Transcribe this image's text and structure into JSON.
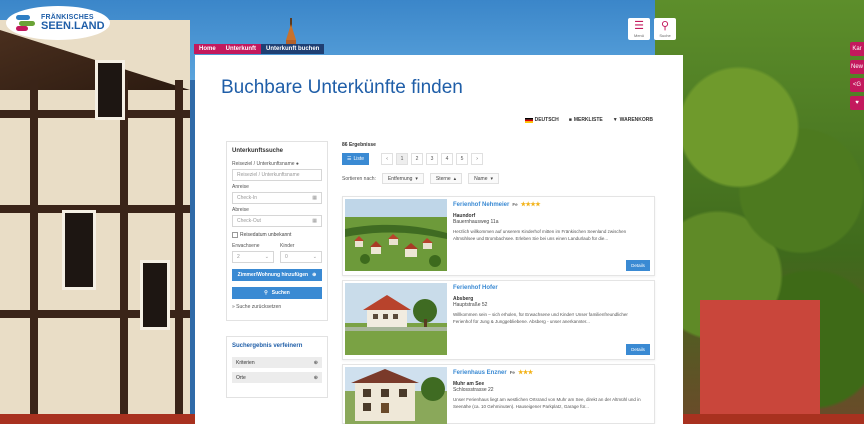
{
  "logo": {
    "line1": "FRÄNKISCHES",
    "line2": "SEEN.LAND"
  },
  "header": {
    "menu_label": "Menü",
    "search_label": "Suche"
  },
  "side_tabs": [
    "Kar",
    "New",
    "<G",
    "♥"
  ],
  "breadcrumb": [
    "Home",
    "Unterkunft",
    "Unterkunft buchen"
  ],
  "page_title": "Buchbare Unterkünfte finden",
  "lang_bar": {
    "language": "DEUTSCH",
    "watchlist": "MERKLISTE",
    "cart": "WARENKORB"
  },
  "search": {
    "heading": "Unterkunftssuche",
    "name_label": "Reiseziel / Unterkunftsname",
    "name_placeholder": "Reiseziel / Unterkunftsname",
    "arrival_label": "Anreise",
    "arrival_placeholder": "Check-In",
    "departure_label": "Abreise",
    "departure_placeholder": "Check-Out",
    "flexible_label": "Reisedatum unbekannt",
    "adults_label": "Erwachsene",
    "adults_value": "2",
    "children_label": "Kinder",
    "children_value": "0",
    "add_room_label": "Zimmer/Wohnung hinzufügen",
    "search_button": "Suchen",
    "reset_link": "» Suche zurücksetzen"
  },
  "saved": {
    "heading": "Suchergebnis verfeinern",
    "items": [
      "Kriterien",
      "Orte"
    ]
  },
  "results": {
    "count": "86 Ergebnisse",
    "list_button": "Liste",
    "pages": [
      "‹",
      "1",
      "2",
      "3",
      "4",
      "5",
      "›"
    ],
    "current_page": "1",
    "sort_label": "Sortieren nach:",
    "sort_options": [
      "Entfernung",
      "Sterne",
      "Name"
    ]
  },
  "cards": [
    {
      "title": "Ferienhof Nehmeier",
      "category": "Fe",
      "stars": "★★★★",
      "name": "Haundorf",
      "address": "Bauernhausweg 11a",
      "description": "Herzlich willkommen auf unserem Kinderhof mitten im Fränkischen Seenland zwischen Altmühlsee und Brombachsee. Erleben Sie bei uns einen Landurlaub für die...",
      "button": "Details"
    },
    {
      "title": "Ferienhof Hofer",
      "category": "",
      "stars": "",
      "name": "Absberg",
      "address": "Hauptstraße 52",
      "description": "Willkommen sein – sich erholen, für Erwachsene und Kinder! Unser familienfreundlicher Ferienhof für Jung & Junggebliebene. Absberg - unser anerkannter...",
      "button": "Details"
    },
    {
      "title": "Ferienhaus Enzner",
      "category": "Fe",
      "stars": "★★★",
      "name": "Muhr am See",
      "address": "Schlossstrasse 22",
      "description": "Unser Ferienhaus liegt am westlichen Ortsrand von Muhr am See, direkt an der Altmühl und in Seenähe (ca. 10 Gehminuten). Hauseigener Parkplatz, Garage für...",
      "button": "Details"
    }
  ],
  "colors": {
    "brand_blue": "#1f5ea8",
    "accent_pink": "#c3195d",
    "button_blue": "#3a8ad3",
    "star_gold": "#f2b218"
  }
}
